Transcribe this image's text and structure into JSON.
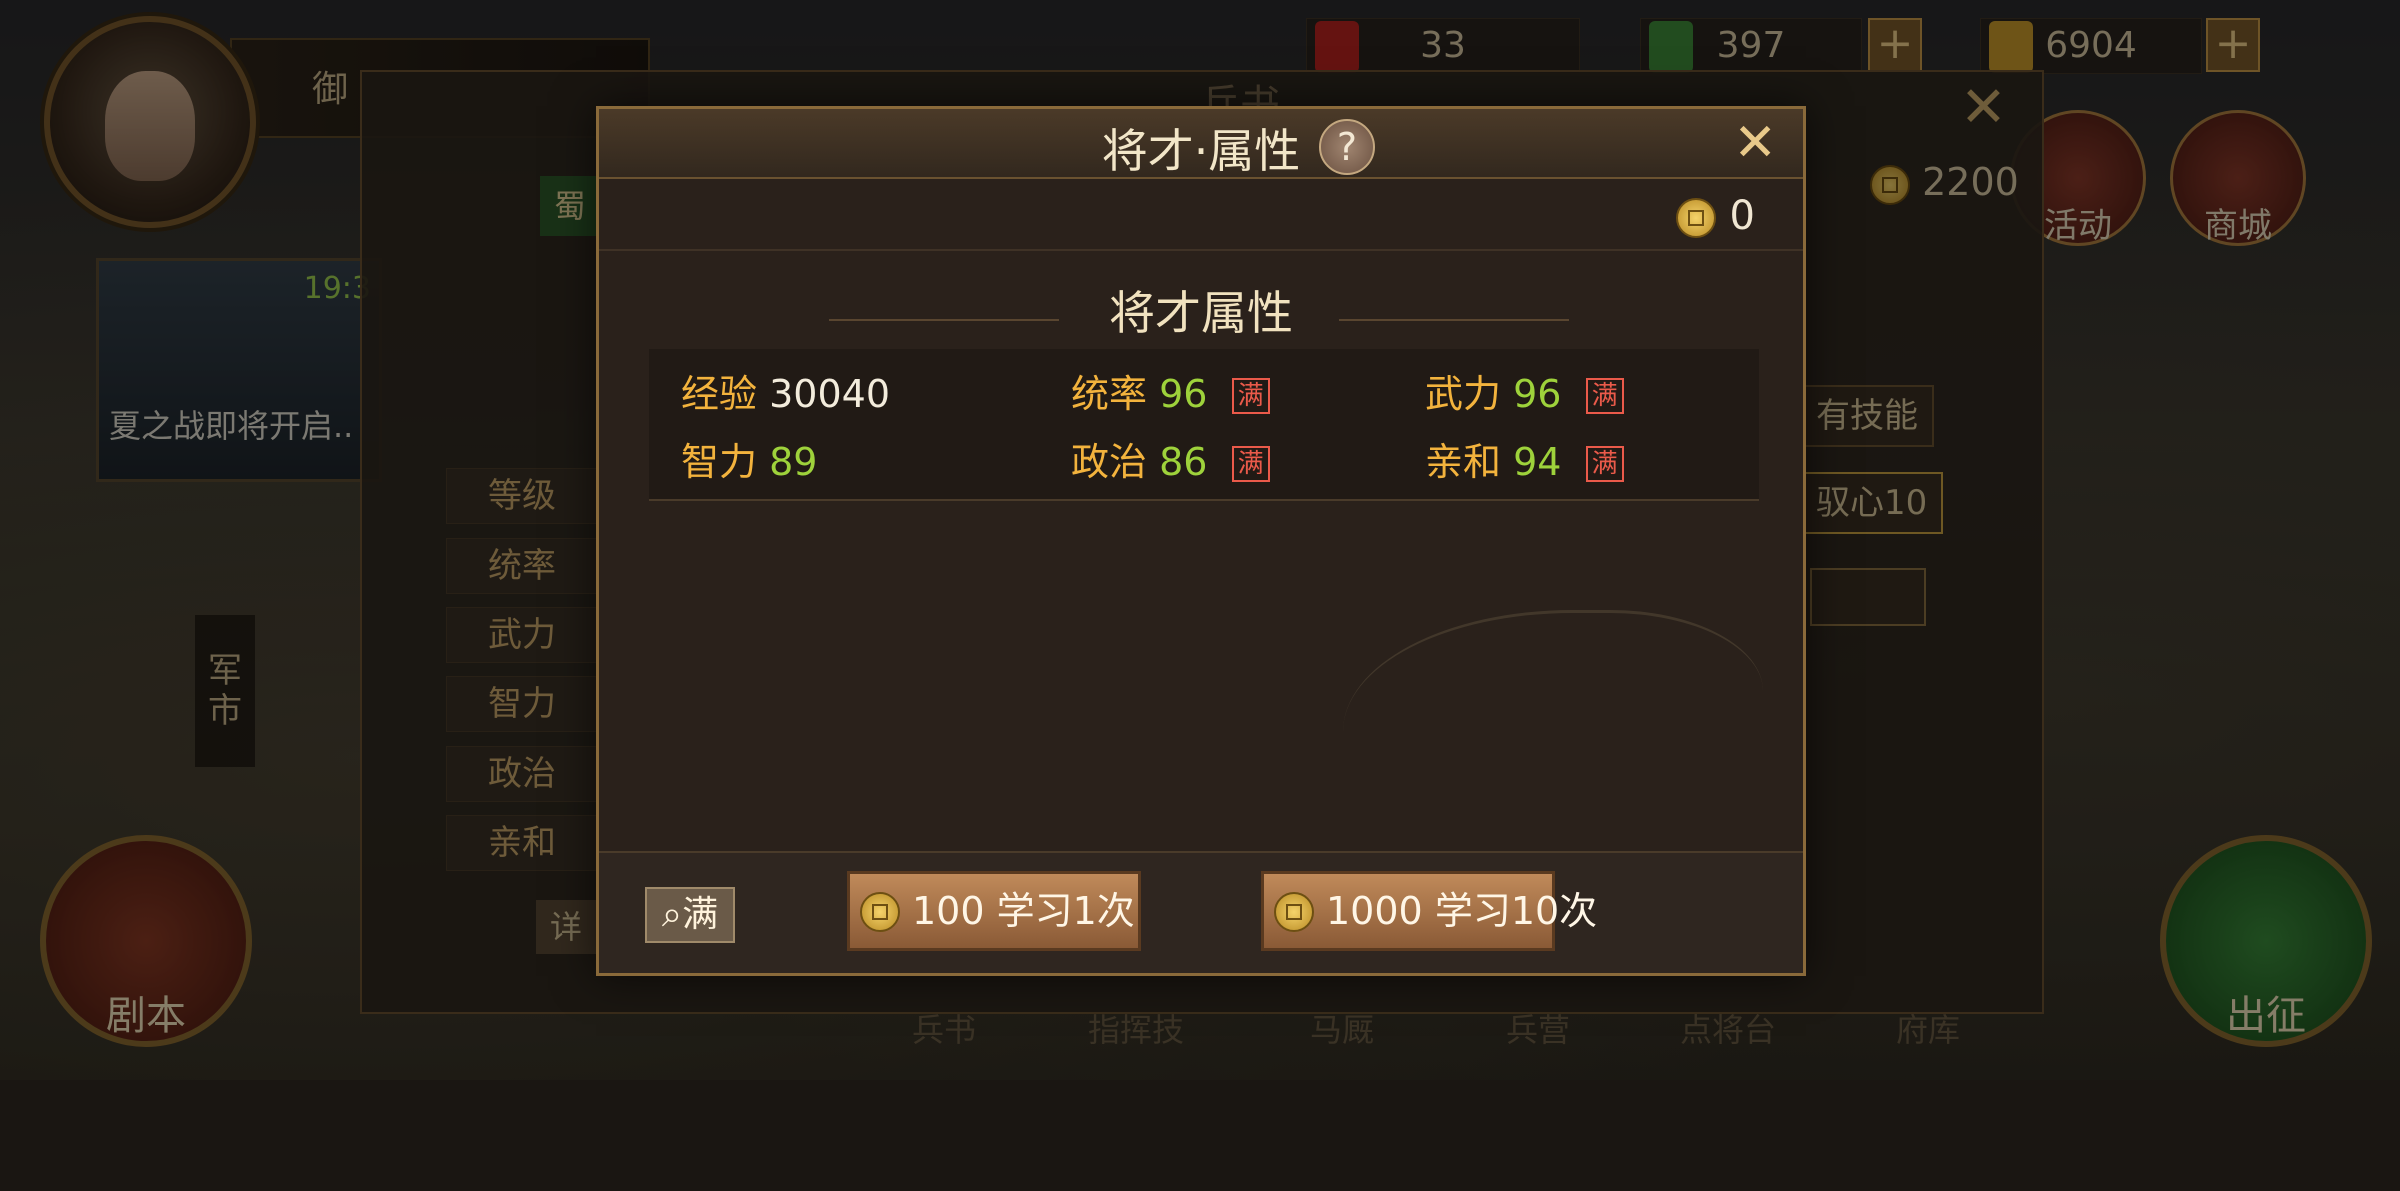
{
  "top_bar": {
    "name_plate": "御",
    "resources": [
      {
        "name": "token",
        "value": "33",
        "icon": "red-token-icon"
      },
      {
        "name": "jade",
        "value": "397",
        "icon": "jade-icon"
      },
      {
        "name": "gold",
        "value": "6904",
        "icon": "gold-bar-icon"
      }
    ],
    "plus_label": "+",
    "event_label": "活动",
    "shop_label": "商城"
  },
  "background_panel": {
    "title": "兵书",
    "close": "✕",
    "coin_count": "2200",
    "faction": "蜀",
    "news_time": "19:3",
    "news_text": "夏之战即将开启..",
    "left_labels": [
      "等级",
      "统率",
      "武力",
      "智力",
      "政治",
      "亲和"
    ],
    "detail_label": "详",
    "right_items": [
      "有技能",
      "驭心10"
    ],
    "market_label": "军市",
    "script_label": "剧本",
    "go_label": "出征",
    "bottom_nav": [
      "兵书",
      "指挥技",
      "马厩",
      "兵营",
      "点将台",
      "府库"
    ]
  },
  "modal": {
    "title": "将才·属性",
    "help": "?",
    "close": "✕",
    "coin_balance": "0",
    "section_title": "将才属性",
    "full_tag": "满",
    "stats": [
      {
        "label": "经验",
        "value": "30040",
        "full": false
      },
      {
        "label": "统率",
        "value": "96",
        "full": true
      },
      {
        "label": "武力",
        "value": "96",
        "full": true
      },
      {
        "label": "智力",
        "value": "89",
        "full": false
      },
      {
        "label": "政治",
        "value": "86",
        "full": true
      },
      {
        "label": "亲和",
        "value": "94",
        "full": true
      }
    ],
    "filter_button": "满",
    "learn_once": {
      "cost": "100",
      "label": "学习1次"
    },
    "learn_ten": {
      "cost": "1000",
      "label": "学习10次"
    }
  },
  "colors": {
    "accent_gold": "#f3b33d",
    "value_green": "#9ed23b",
    "full_red": "#ea5a4a",
    "title_text": "#f2e6c8"
  }
}
